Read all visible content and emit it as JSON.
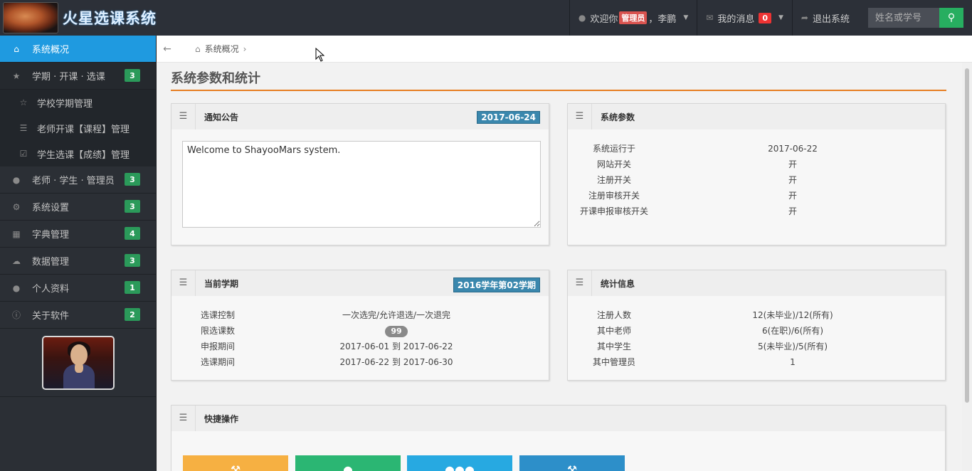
{
  "app": {
    "title": "火星选课系统"
  },
  "navbar": {
    "welcome_prefix": "欢迎你",
    "role_badge": "管理员",
    "welcome_suffix": "，李鹏",
    "messages_label": "我的消息",
    "messages_count": "0",
    "logout_label": "退出系统",
    "search_placeholder": "姓名或学号"
  },
  "sidebar": {
    "items": [
      {
        "label": "系统概况",
        "icon": "home-icon",
        "active": true
      },
      {
        "label": "学期 · 开课 · 选课",
        "icon": "star-icon",
        "count": "3"
      },
      {
        "label": "老师 · 学生 · 管理员",
        "icon": "users-icon",
        "count": "3"
      },
      {
        "label": "系统设置",
        "icon": "gear-icon",
        "count": "3"
      },
      {
        "label": "字典管理",
        "icon": "book-icon",
        "count": "4"
      },
      {
        "label": "数据管理",
        "icon": "cloud-icon",
        "count": "3"
      },
      {
        "label": "个人资料",
        "icon": "user-icon",
        "count": "1"
      },
      {
        "label": "关于软件",
        "icon": "info-icon",
        "count": "2"
      }
    ],
    "submenu": [
      {
        "label": "学校学期管理",
        "icon": "star-outline-icon"
      },
      {
        "label": "老师开课【课程】管理",
        "icon": "list-icon"
      },
      {
        "label": "学生选课【成绩】管理",
        "icon": "check-square-icon"
      }
    ]
  },
  "breadcrumb": {
    "current": "系统概况"
  },
  "page": {
    "title": "系统参数和统计"
  },
  "notice": {
    "title": "通知公告",
    "date": "2017-06-24",
    "text": "Welcome to ShayooMars system."
  },
  "params": {
    "title": "系统参数",
    "rows": [
      {
        "k": "系统运行于",
        "v": "2017-06-22"
      },
      {
        "k": "网站开关",
        "v": "开"
      },
      {
        "k": "注册开关",
        "v": "开"
      },
      {
        "k": "注册审核开关",
        "v": "开"
      },
      {
        "k": "开课申报审核开关",
        "v": "开"
      }
    ]
  },
  "term": {
    "title": "当前学期",
    "label": "2016学年第02学期",
    "rows": [
      {
        "k": "选课控制",
        "v": "一次选完/允许退选/一次退完"
      },
      {
        "k": "限选课数",
        "v": "99"
      },
      {
        "k": "申报期间",
        "v": "2017-06-01 到 2017-06-22"
      },
      {
        "k": "选课期间",
        "v": "2017-06-22 到 2017-06-30"
      }
    ]
  },
  "stats": {
    "title": "统计信息",
    "rows": [
      {
        "k": "注册人数",
        "v": "12(未毕业)/12(所有)"
      },
      {
        "k": "其中老师",
        "v": "6(在职)/6(所有)"
      },
      {
        "k": "其中学生",
        "v": "5(未毕业)/5(所有)"
      },
      {
        "k": "其中管理员",
        "v": "1"
      }
    ]
  },
  "quick": {
    "title": "快捷操作",
    "buttons": [
      {
        "icon": "wrench-icon",
        "color": "#f6b042"
      },
      {
        "icon": "user-icon",
        "color": "#2bb673"
      },
      {
        "icon": "users-icon",
        "color": "#27a9e1"
      },
      {
        "icon": "wrench-icon",
        "color": "#2d8fc9"
      }
    ]
  }
}
